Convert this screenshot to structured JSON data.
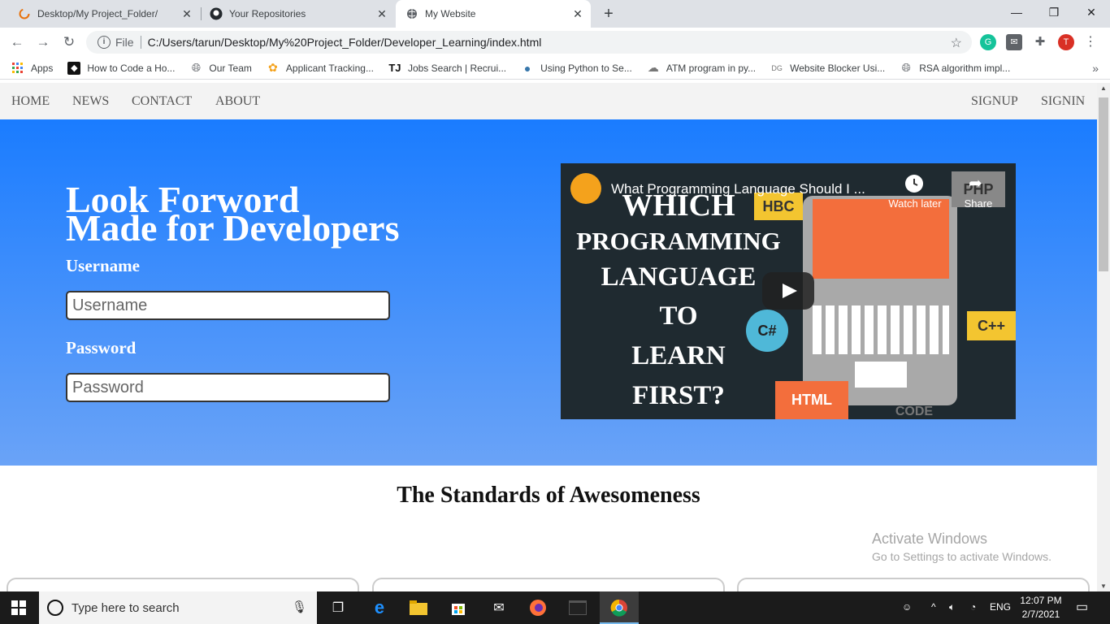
{
  "browser": {
    "tabs": [
      {
        "title": "Desktop/My Project_Folder/",
        "icon": "loading-spinner-icon"
      },
      {
        "title": "Your Repositories",
        "icon": "github-icon"
      },
      {
        "title": "My Website",
        "icon": "globe-icon",
        "active": true
      }
    ],
    "address": {
      "scheme_label": "File",
      "url": "C:/Users/tarun/Desktop/My%20Project_Folder/Developer_Learning/index.html"
    },
    "profile_initial": "T",
    "bookmarks": [
      {
        "label": "Apps",
        "icon": "apps-grid-icon"
      },
      {
        "label": "How to Code a Ho...",
        "icon": "codepen-icon"
      },
      {
        "label": "Our Team",
        "icon": "globe-icon"
      },
      {
        "label": "Applicant Tracking...",
        "icon": "pinwheel-icon"
      },
      {
        "label": "Jobs Search | Recrui...",
        "icon": "tj-icon"
      },
      {
        "label": "Using Python to Se...",
        "icon": "python-icon"
      },
      {
        "label": "ATM program in py...",
        "icon": "cloud-icon"
      },
      {
        "label": "Website Blocker Usi...",
        "icon": "dg-icon"
      },
      {
        "label": "RSA algorithm impl...",
        "icon": "globe-icon"
      }
    ]
  },
  "site": {
    "nav_left": [
      "HOME",
      "NEWS",
      "CONTACT",
      "ABOUT"
    ],
    "nav_right": [
      "SIGNUP",
      "SIGNIN"
    ],
    "hero": {
      "title_line1": "Look Forword",
      "title_line2": "Made for Developers",
      "username_label": "Username",
      "username_placeholder": "Username",
      "password_label": "Password",
      "password_placeholder": "Password"
    },
    "video": {
      "title": "What Programming Language Should I ...",
      "watch_later": "Watch later",
      "share": "Share",
      "thumb_lines": [
        "WHICH",
        "PROGRAMMING",
        "LANGUAGE",
        "TO",
        "LEARN",
        "FIRST?"
      ],
      "tags": {
        "hbc": "HBC",
        "php": "PHP",
        "csharp": "C#",
        "cpp": "C++",
        "html": "HTML",
        "code": "CODE"
      }
    },
    "section_title": "The Standards of Awesomeness",
    "watermark": {
      "line1": "Activate Windows",
      "line2": "Go to Settings to activate Windows."
    }
  },
  "taskbar": {
    "search_placeholder": "Type here to search",
    "language": "ENG",
    "time": "12:07 PM",
    "date": "2/7/2021"
  },
  "colors": {
    "hero_top": "#1a7cff",
    "hero_bottom": "#6aa3f7",
    "profile": "#d93025"
  }
}
